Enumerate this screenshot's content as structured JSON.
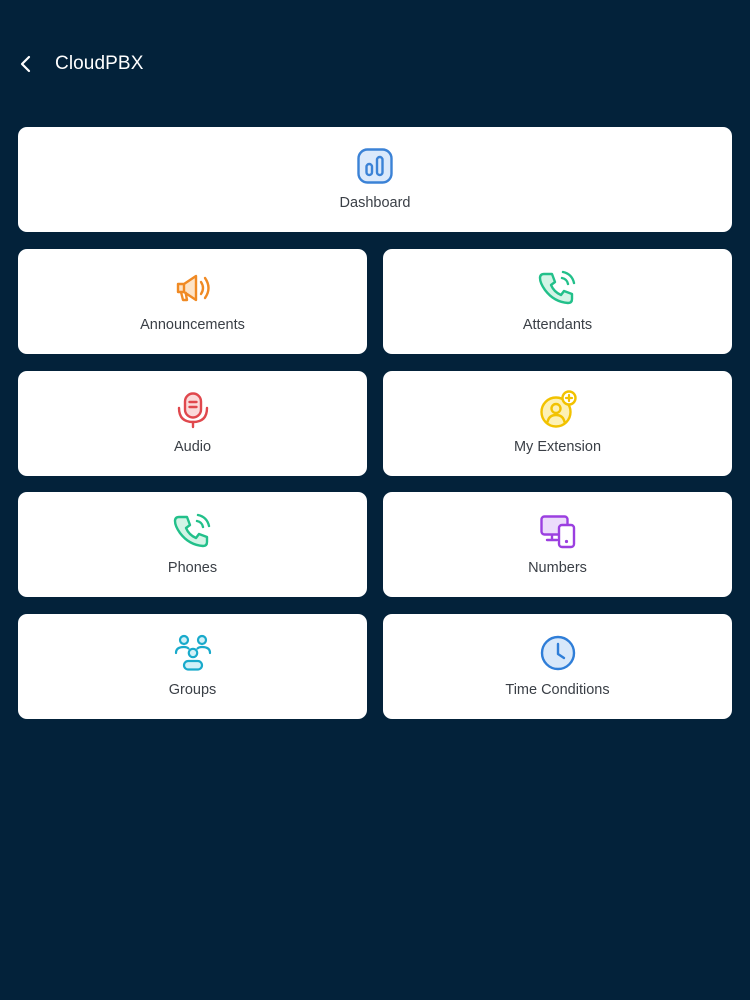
{
  "header": {
    "title": "CloudPBX",
    "back_icon": "chevron-left-icon"
  },
  "menu": {
    "dashboard": {
      "label": "Dashboard",
      "icon": "bar-chart-icon",
      "color": "#3b82d6"
    },
    "announcements": {
      "label": "Announcements",
      "icon": "megaphone-icon",
      "color": "#f08a24"
    },
    "attendants": {
      "label": "Attendants",
      "icon": "phone-ringing-icon",
      "color": "#22c08a"
    },
    "audio": {
      "label": "Audio",
      "icon": "microphone-icon",
      "color": "#e0484d"
    },
    "my_extension": {
      "label": "My Extension",
      "icon": "user-add-icon",
      "color": "#f2c200"
    },
    "phones": {
      "label": "Phones",
      "icon": "phone-ringing-icon",
      "color": "#22c08a"
    },
    "numbers": {
      "label": "Numbers",
      "icon": "devices-icon",
      "color": "#9b3fe0"
    },
    "groups": {
      "label": "Groups",
      "icon": "users-group-icon",
      "color": "#19aacb"
    },
    "time_conditions": {
      "label": "Time Conditions",
      "icon": "clock-icon",
      "color": "#2f7ed8"
    }
  },
  "colors": {
    "background": "#03223a",
    "card": "#ffffff",
    "label_text": "#3a3f46"
  }
}
